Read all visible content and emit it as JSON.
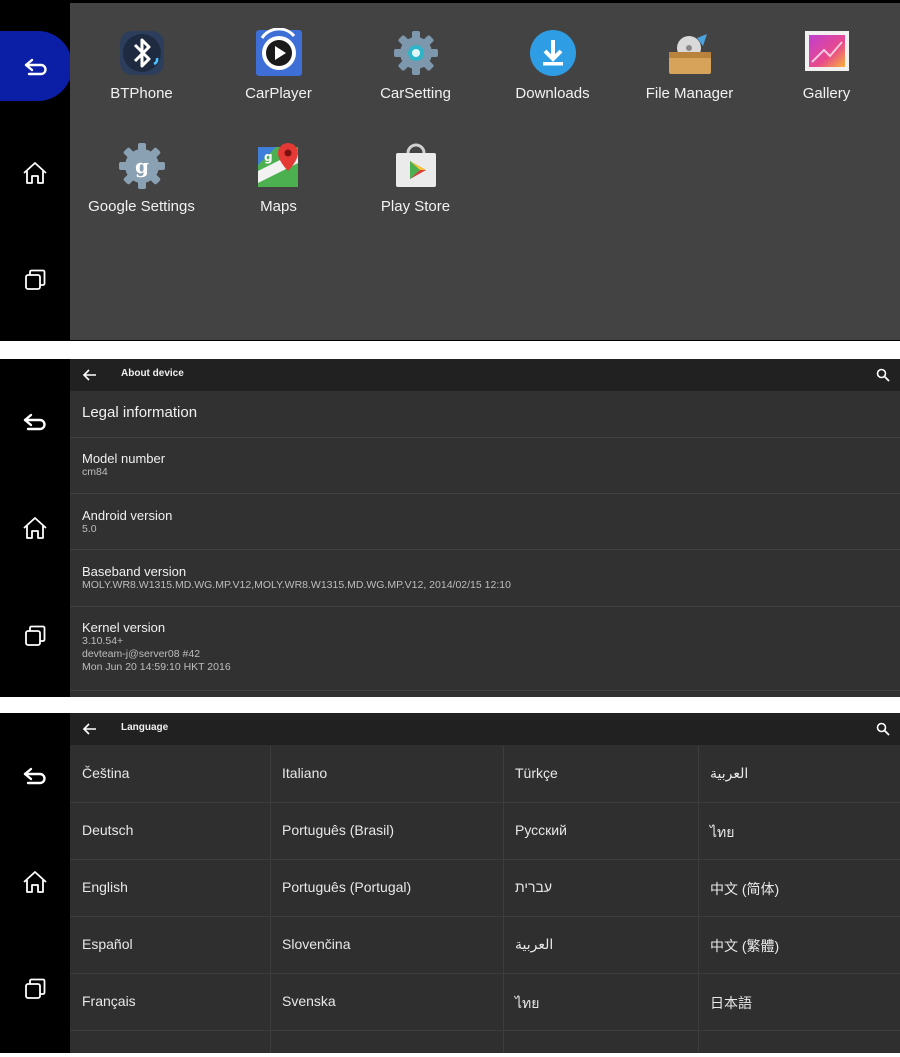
{
  "apps": [
    {
      "label": "BTPhone",
      "icon": "bluetooth-icon"
    },
    {
      "label": "CarPlayer",
      "icon": "play-icon"
    },
    {
      "label": "CarSetting",
      "icon": "gear-icon"
    },
    {
      "label": "Downloads",
      "icon": "download-icon"
    },
    {
      "label": "File Manager",
      "icon": "folder-icon"
    },
    {
      "label": "Gallery",
      "icon": "image-icon"
    },
    {
      "label": "Google Settings",
      "icon": "google-gear-icon"
    },
    {
      "label": "Maps",
      "icon": "map-pin-icon"
    },
    {
      "label": "Play Store",
      "icon": "play-store-icon"
    }
  ],
  "about": {
    "title": "About device",
    "rows": [
      {
        "title": "Legal information"
      },
      {
        "title": "Model number",
        "lines": [
          "cm84"
        ]
      },
      {
        "title": "Android version",
        "lines": [
          "5.0"
        ]
      },
      {
        "title": "Baseband version",
        "lines": [
          "MOLY.WR8.W1315.MD.WG.MP.V12,MOLY.WR8.W1315.MD.WG.MP.V12, 2014/02/15 12:10"
        ]
      },
      {
        "title": "Kernel version",
        "lines": [
          "3.10.54+",
          "devteam-j@server08 #42",
          "Mon Jun 20 14:59:10 HKT 2016"
        ]
      }
    ]
  },
  "language": {
    "title": "Language",
    "columns": [
      [
        "Čeština",
        "Deutsch",
        "English",
        "Español",
        "Français"
      ],
      [
        "Italiano",
        "Português (Brasil)",
        "Português (Portugal)",
        "Slovenčina",
        "Svenska"
      ],
      [
        "Türkçe",
        "Русский",
        "עברית",
        "العربية",
        "ไทย"
      ],
      [
        "العربية",
        "ไทย",
        "中文 (简体)",
        "中文 (繁體)",
        "日本語"
      ]
    ]
  },
  "colors": {
    "accent": "#0b1fa6",
    "grid_bg": "#434343",
    "settings_bg": "#313131",
    "toolbar": "#212121"
  }
}
